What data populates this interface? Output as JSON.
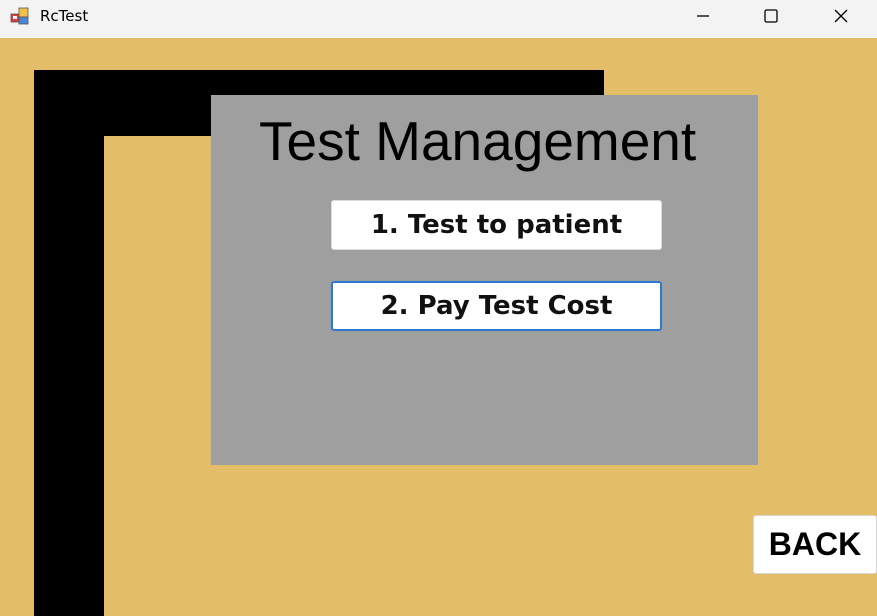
{
  "window": {
    "title": "RcTest"
  },
  "panel": {
    "title": "Test Management",
    "buttons": [
      {
        "label": "1. Test to patient"
      },
      {
        "label": "2. Pay Test Cost"
      }
    ]
  },
  "back_button": {
    "label": "BACK"
  },
  "icons": {
    "app": "app-icon",
    "minimize": "minimize-icon",
    "maximize": "maximize-icon",
    "close": "close-icon"
  },
  "colors": {
    "background": "#e4bd68",
    "panel": "#9f9f9f",
    "accent_border": "#2b79d0",
    "bars": "#000000"
  }
}
